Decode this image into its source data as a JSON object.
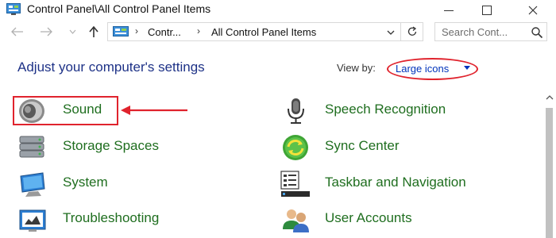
{
  "window": {
    "title": "Control Panel\\All Control Panel Items",
    "min_icon": "minimize-icon",
    "max_icon": "maximize-icon",
    "close_icon": "close-icon"
  },
  "address_bar": {
    "segments": [
      "Contr...",
      "All Control Panel Items"
    ],
    "search_placeholder": "Search Cont..."
  },
  "header": {
    "heading": "Adjust your computer's settings",
    "view_by_label": "View by:",
    "view_by_value": "Large icons"
  },
  "items": [
    {
      "label": "Sound",
      "icon": "speaker-icon"
    },
    {
      "label": "Speech Recognition",
      "icon": "microphone-icon"
    },
    {
      "label": "Storage Spaces",
      "icon": "storage-drives-icon"
    },
    {
      "label": "Sync Center",
      "icon": "sync-icon"
    },
    {
      "label": "System",
      "icon": "computer-monitor-icon"
    },
    {
      "label": "Taskbar and Navigation",
      "icon": "taskbar-icon"
    },
    {
      "label": "Troubleshooting",
      "icon": "troubleshooting-icon"
    },
    {
      "label": "User Accounts",
      "icon": "users-icon"
    }
  ],
  "colors": {
    "heading": "#1e3287",
    "item_label": "#1f6e1f",
    "link": "#0033bb",
    "annotation": "#e0232d"
  }
}
